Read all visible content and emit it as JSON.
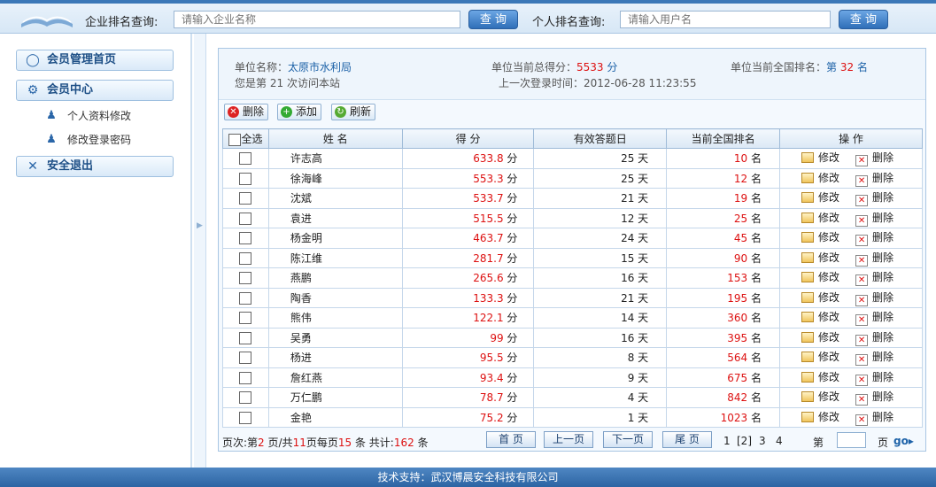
{
  "header": {
    "company_label": "企业排名查询:",
    "company_placeholder": "请输入企业名称",
    "query_btn": "查 询",
    "person_label": "个人排名查询:",
    "person_placeholder": "请输入用户名"
  },
  "sidebar": {
    "home": "会员管理首页",
    "center": "会员中心",
    "profile": "个人资料修改",
    "password": "修改登录密码",
    "logout": "安全退出"
  },
  "info": {
    "unit_label": "单位名称：",
    "unit_name": "太原市水利局",
    "visit_a": "您是第",
    "visit_n": "21",
    "visit_b": "次访问本站",
    "score_label": "单位当前总得分：",
    "score_value": "5533",
    "score_unit": "分",
    "last_login": "上一次登录时间：2012-06-28 11:23:55",
    "rank_label": "单位当前全国排名：",
    "rank_a": "第",
    "rank_value": "32",
    "rank_b": "名"
  },
  "toolbar": {
    "delete": "删除",
    "add": "添加",
    "refresh": "刷新"
  },
  "table": {
    "headers": [
      "全选",
      "姓 名",
      "得 分",
      "有效答题日",
      "当前全国排名",
      "操 作"
    ],
    "edit": "修改",
    "remove": "删除",
    "score_unit": "分",
    "day_unit": "天",
    "rank_unit": "名",
    "rows": [
      {
        "name": "许志高",
        "score": "633.8",
        "days": "25",
        "rank": "10"
      },
      {
        "name": "徐海峰",
        "score": "553.3",
        "days": "25",
        "rank": "12"
      },
      {
        "name": "沈斌",
        "score": "533.7",
        "days": "21",
        "rank": "19"
      },
      {
        "name": "袁进",
        "score": "515.5",
        "days": "12",
        "rank": "25"
      },
      {
        "name": "杨金明",
        "score": "463.7",
        "days": "24",
        "rank": "45"
      },
      {
        "name": "陈江维",
        "score": "281.7",
        "days": "15",
        "rank": "90"
      },
      {
        "name": "燕鹏",
        "score": "265.6",
        "days": "16",
        "rank": "153"
      },
      {
        "name": "陶香",
        "score": "133.3",
        "days": "21",
        "rank": "195"
      },
      {
        "name": "熊伟",
        "score": "122.1",
        "days": "14",
        "rank": "360"
      },
      {
        "name": "吴勇",
        "score": "99",
        "days": "16",
        "rank": "395"
      },
      {
        "name": "杨进",
        "score": "95.5",
        "days": "8",
        "rank": "564"
      },
      {
        "name": "詹红燕",
        "score": "93.4",
        "days": "9",
        "rank": "675"
      },
      {
        "name": "万仁鹏",
        "score": "78.7",
        "days": "4",
        "rank": "842"
      },
      {
        "name": "金艳",
        "score": "75.2",
        "days": "1",
        "rank": "1023"
      }
    ]
  },
  "pager": {
    "p1": "页次:第",
    "cur": "2",
    "p2": "页/共",
    "total": "11",
    "p3": "页每页",
    "per": "15",
    "p4": "条 共计:",
    "count": "162",
    "p5": "条",
    "first": "首 页",
    "prev": "上一页",
    "next": "下一页",
    "last": "尾 页",
    "pages": [
      "1",
      "[2]",
      "3",
      "4"
    ],
    "goto_a": "第",
    "goto_b": "页",
    "go": "go"
  },
  "footer": "技术支持：武汉博晨安全科技有限公司"
}
